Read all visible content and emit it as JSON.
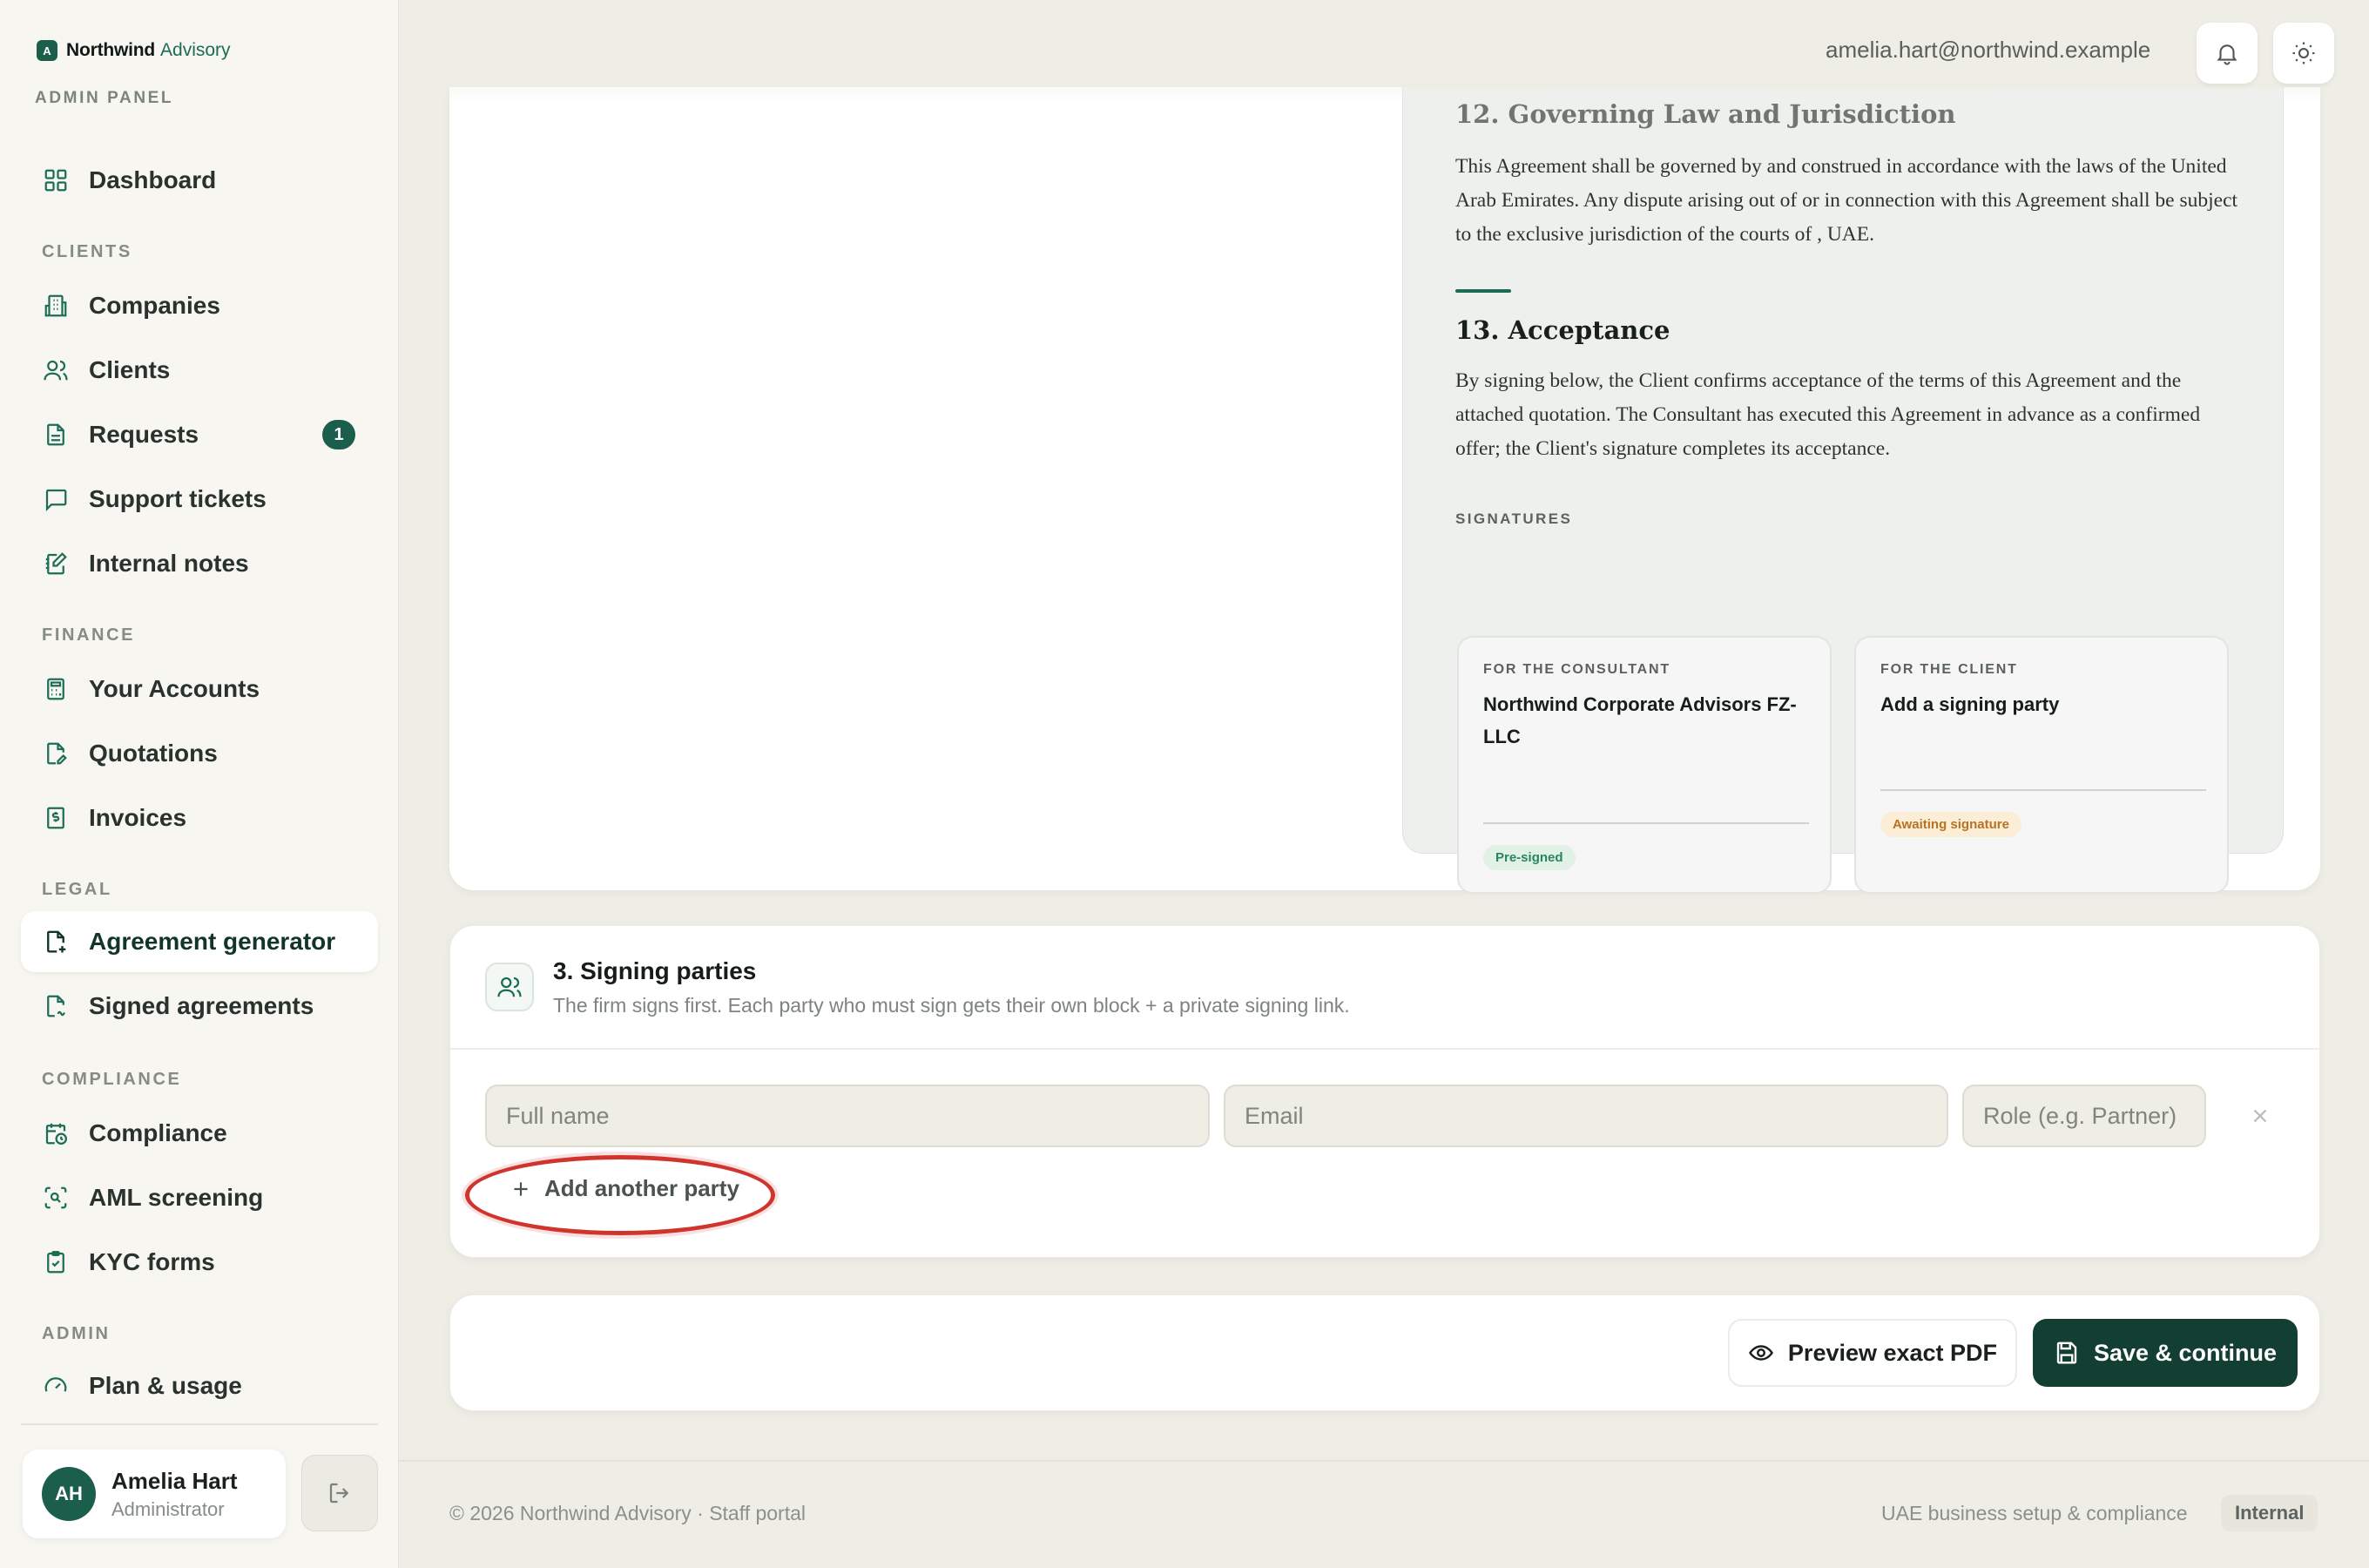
{
  "brand": {
    "name": "Northwind",
    "accent": "Advisory",
    "mark": "A",
    "panel_label": "ADMIN PANEL"
  },
  "sidebar": {
    "sections": {
      "clients": "CLIENTS",
      "finance": "FINANCE",
      "legal": "LEGAL",
      "compliance": "COMPLIANCE",
      "admin": "ADMIN"
    },
    "items": [
      {
        "label": "Dashboard",
        "icon": "grid-icon"
      },
      {
        "label": "Companies",
        "icon": "building-icon"
      },
      {
        "label": "Clients",
        "icon": "users-icon"
      },
      {
        "label": "Requests",
        "icon": "file-icon",
        "badge": "1"
      },
      {
        "label": "Support tickets",
        "icon": "chat-icon"
      },
      {
        "label": "Internal notes",
        "icon": "notebook-pen-icon"
      },
      {
        "label": "Your Accounts",
        "icon": "calculator-icon"
      },
      {
        "label": "Quotations",
        "icon": "file-pen-icon"
      },
      {
        "label": "Invoices",
        "icon": "receipt-dollar-icon"
      },
      {
        "label": "Agreement generator",
        "icon": "file-plus-icon",
        "active": true
      },
      {
        "label": "Signed agreements",
        "icon": "file-signature-icon"
      },
      {
        "label": "Compliance",
        "icon": "calendar-clock-icon"
      },
      {
        "label": "AML screening",
        "icon": "scan-search-icon"
      },
      {
        "label": "KYC forms",
        "icon": "clipboard-check-icon"
      },
      {
        "label": "Plan & usage",
        "icon": "gauge-icon"
      }
    ],
    "user": {
      "initials": "AH",
      "name": "Amelia Hart",
      "role": "Administrator"
    }
  },
  "topbar": {
    "email": "amelia.hart@northwind.example"
  },
  "document": {
    "section12_title": "12. Governing Law and Jurisdiction",
    "section12_body": "This Agreement shall be governed by and construed in accordance with the laws of the United Arab Emirates. Any dispute arising out of or in connection with this Agreement shall be subject to the exclusive jurisdiction of the courts of , UAE.",
    "section13_title": "13. Acceptance",
    "section13_body": "By signing below, the Client confirms acceptance of the terms of this Agreement and the attached quotation. The Consultant has executed this Agreement in advance as a confirmed offer; the Client's signature completes its acceptance.",
    "signatures_label": "SIGNATURES",
    "consultant": {
      "for": "FOR THE CONSULTANT",
      "party": "Northwind Corporate Advisors FZ-LLC",
      "status": "Pre-signed"
    },
    "client": {
      "for": "FOR THE CLIENT",
      "party": "Add a signing party",
      "status": "Awaiting signature"
    }
  },
  "signing_parties": {
    "title": "3. Signing parties",
    "subtitle": "The firm signs first. Each party who must sign gets their own block + a private signing link.",
    "fields": {
      "name_placeholder": "Full name",
      "email_placeholder": "Email",
      "role_placeholder": "Role (e.g. Partner)"
    },
    "add_label": "Add another party"
  },
  "actions": {
    "preview_label": "Preview exact PDF",
    "save_label": "Save & continue"
  },
  "footer": {
    "left": "© 2026 Northwind Advisory · Staff portal",
    "right": "UAE business setup & compliance",
    "badge": "Internal"
  },
  "colors": {
    "brand": "#1c5e4c",
    "primary_button": "#133f33",
    "annotation": "#d1342c"
  }
}
